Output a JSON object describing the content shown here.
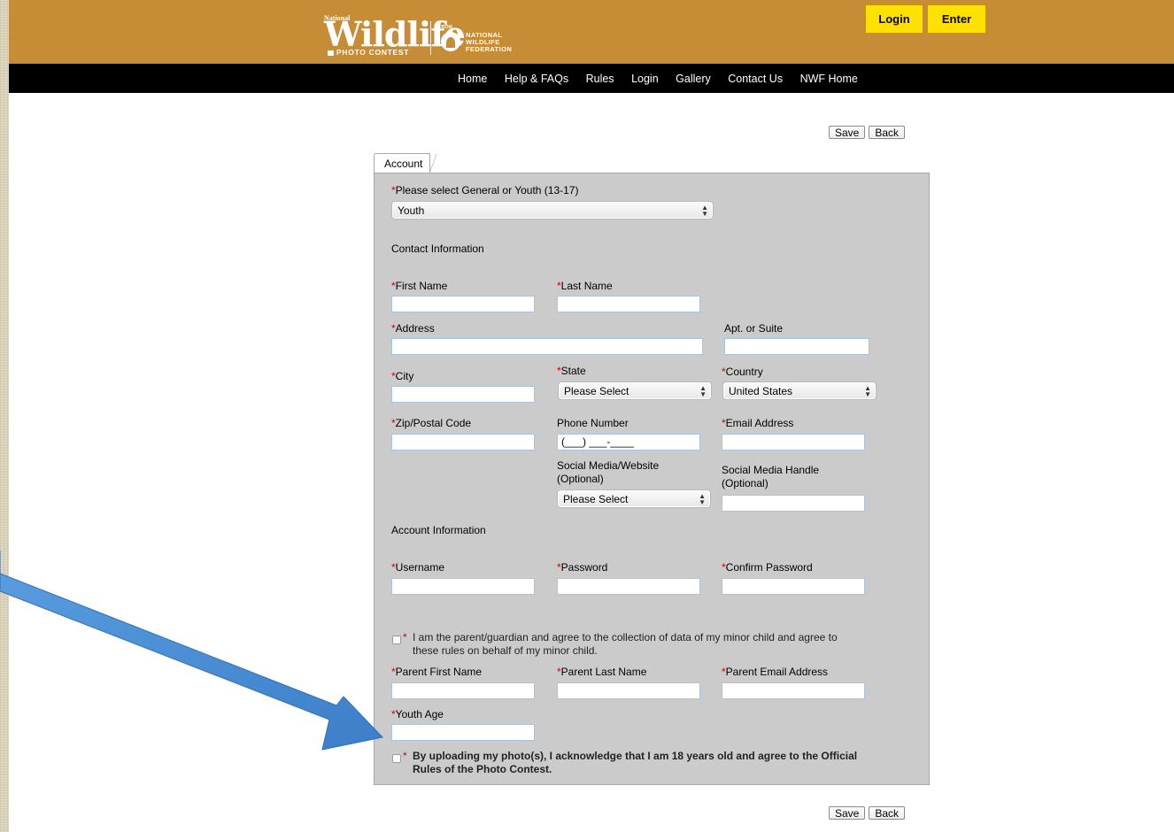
{
  "header": {
    "logo": {
      "national": "National",
      "wildlife": "Wildlife",
      "photo_contest": "PHOTO CONTEST",
      "from": "FROM",
      "nwf_line1": "NATIONAL",
      "nwf_line2": "WILDLIFE",
      "nwf_line3": "FEDERATION"
    },
    "login_label": "Login",
    "enter_label": "Enter",
    "bg_color": "#c68c36",
    "button_color": "#ffe100"
  },
  "nav": {
    "items": [
      "Home",
      "Help & FAQs",
      "Rules",
      "Login",
      "Gallery",
      "Contact Us",
      "NWF Home"
    ]
  },
  "actions": {
    "save_label": "Save",
    "back_label": "Back"
  },
  "tab": {
    "label": "Account"
  },
  "form": {
    "category": {
      "label": "Please select General or Youth (13-17)",
      "value": "Youth"
    },
    "contact_heading": "Contact Information",
    "first_name": {
      "label": "First Name",
      "value": ""
    },
    "last_name": {
      "label": "Last Name",
      "value": ""
    },
    "address": {
      "label": "Address",
      "value": ""
    },
    "apt": {
      "label": "Apt. or Suite",
      "value": ""
    },
    "city": {
      "label": "City",
      "value": ""
    },
    "state": {
      "label": "State",
      "value": "Please Select"
    },
    "country": {
      "label": "Country",
      "value": "United States"
    },
    "zip": {
      "label": "Zip/Postal Code",
      "value": ""
    },
    "phone": {
      "label": "Phone Number",
      "value": "(___) ___-____"
    },
    "email": {
      "label": "Email Address",
      "value": ""
    },
    "social_site": {
      "label_line1": "Social Media/Website",
      "label_line2": "(Optional)",
      "value": "Please Select"
    },
    "social_handle": {
      "label_line1": "Social Media Handle",
      "label_line2": "(Optional)",
      "value": ""
    },
    "account_heading": "Account Information",
    "username": {
      "label": "Username",
      "value": ""
    },
    "password": {
      "label": "Password",
      "value": ""
    },
    "confirm_password": {
      "label": "Confirm Password",
      "value": ""
    },
    "guardian_consent": {
      "line1": "I am the parent/guardian and agree to the collection of data of my minor child and agree to",
      "line2": "these rules on behalf of my minor child.",
      "checked": false
    },
    "parent_first_name": {
      "label": "Parent First Name",
      "value": ""
    },
    "parent_last_name": {
      "label": "Parent Last Name",
      "value": ""
    },
    "parent_email": {
      "label": "Parent Email Address",
      "value": ""
    },
    "youth_age": {
      "label": "Youth Age",
      "value": ""
    },
    "age_ack": {
      "line1": "By uploading my photo(s), I acknowledge that I am 18 years old and agree to the Official",
      "line2": "Rules of the Photo Contest.",
      "checked": false
    },
    "required_marker": "*"
  },
  "annotation": {
    "arrow_color": "#4a8fd6"
  }
}
